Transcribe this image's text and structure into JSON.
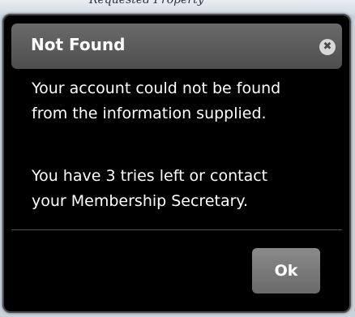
{
  "backdrop": {
    "partial_text": "Requested Property"
  },
  "dialog": {
    "title": "Not Found",
    "close_icon": "close-icon",
    "close_glyph": "✖",
    "message_line_1": "Your account could not be found",
    "message_line_2": "from the information supplied.",
    "message_line_3": "You have 3 tries left or contact",
    "message_line_4": "your Membership Secretary.",
    "ok_label": "Ok"
  }
}
